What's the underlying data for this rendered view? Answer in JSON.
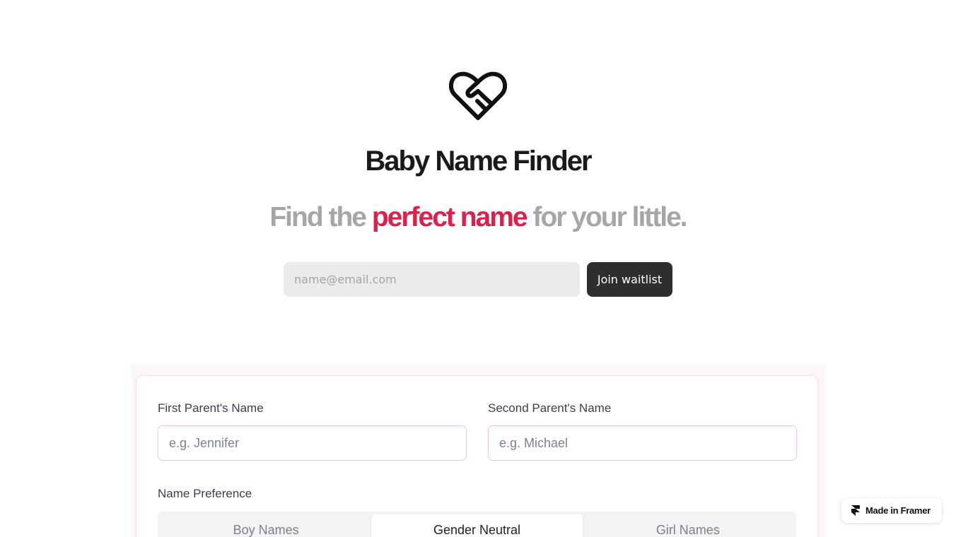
{
  "brand": {
    "logo_icon": "heart-handshake-icon",
    "title": "Baby Name Finder"
  },
  "tagline": {
    "before": "Find the",
    "highlight": "perfect name",
    "after": "for your little.",
    "highlight_color": "#e0204c"
  },
  "waitlist": {
    "email_placeholder": "name@email.com",
    "button_label": "Join waitlist"
  },
  "form": {
    "first_parent_label": "First Parent's Name",
    "first_parent_placeholder": "e.g. Jennifer",
    "second_parent_label": "Second Parent's Name",
    "second_parent_placeholder": "e.g. Michael",
    "preference_label": "Name Preference",
    "preference_options": [
      "Boy Names",
      "Gender Neutral",
      "Girl Names"
    ],
    "preference_selected": "Gender Neutral"
  },
  "badge": {
    "icon": "framer-icon",
    "label": "Made in Framer"
  }
}
